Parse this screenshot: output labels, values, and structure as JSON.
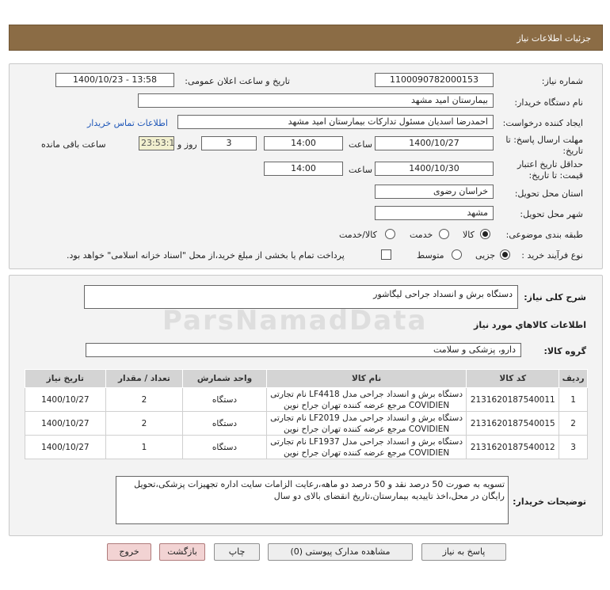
{
  "header": {
    "title": "جزئیات اطلاعات نیاز"
  },
  "form": {
    "need_number_label": "شماره نیاز:",
    "need_number": "1100090782000153",
    "announce_label": "تاریخ و ساعت اعلان عمومی:",
    "announce_value": "1400/10/23 - 13:58",
    "buyer_org_label": "نام دستگاه خریدار:",
    "buyer_org": "بیمارستان امید مشهد",
    "creator_label": "ایجاد کننده درخواست:",
    "creator": "احمدرضا اسدیان مسئول تدارکات بیمارستان امید مشهد",
    "contact_link": "اطلاعات تماس خریدار",
    "deadline_label_1": "مهلت ارسال پاسخ: تا",
    "deadline_label_2": "تاریخ:",
    "deadline_date": "1400/10/27",
    "time_label": "ساعت",
    "deadline_time": "14:00",
    "days_value": "3",
    "days_label": "روز و",
    "remaining_time": "23:53:19",
    "remaining_label": "ساعت باقی مانده",
    "validity_label_1": "حداقل تاریخ اعتبار",
    "validity_label_2": "قیمت: تا تاریخ:",
    "validity_date": "1400/10/30",
    "validity_time_label": "ساعت",
    "validity_time": "14:00",
    "province_label": "استان محل تحویل:",
    "province": "خراسان رضوی",
    "city_label": "شهر محل تحویل:",
    "city": "مشهد",
    "category_label": "طبقه بندی موضوعی:",
    "category_options": [
      "کالا",
      "خدمت",
      "کالا/خدمت"
    ],
    "process_label": "نوع فرآیند خرید :",
    "process_options": [
      "جزیی",
      "متوسط"
    ],
    "payment_note": "پرداخت تمام یا بخشی از مبلغ خرید،از محل \"اسناد خزانه اسلامی\" خواهد بود."
  },
  "details": {
    "summary_label": "شرح کلی نیاز:",
    "summary": "دستگاه برش و انسداد جراحی لیگاشور",
    "goods_info_title": "اطلاعات کالاهاي مورد نياز",
    "goods_group_label": "گروه کالا:",
    "goods_group": "دارو، پزشکی و سلامت",
    "table": {
      "headers": [
        "ردیف",
        "کد کالا",
        "نام کالا",
        "واحد شمارش",
        "تعداد / مقدار",
        "تاریخ نیاز"
      ],
      "rows": [
        {
          "row": "1",
          "code": "2131620187540011",
          "name_1": "دستگاه برش و انسداد جراحی مدل LF4418 نام تجارتی",
          "name_2": "COVIDIEN مرجع عرضه کننده تهران جراح نوین",
          "unit": "دستگاه",
          "qty": "2",
          "date": "1400/10/27"
        },
        {
          "row": "2",
          "code": "2131620187540015",
          "name_1": "دستگاه برش و انسداد جراحی مدل LF2019 نام تجارتی",
          "name_2": "COVIDIEN مرجع عرضه کننده تهران جراح نوین",
          "unit": "دستگاه",
          "qty": "2",
          "date": "1400/10/27"
        },
        {
          "row": "3",
          "code": "2131620187540012",
          "name_1": "دستگاه برش و انسداد جراحی مدل LF1937 نام تجارتی",
          "name_2": "COVIDIEN مرجع عرضه کننده تهران جراح نوین",
          "unit": "دستگاه",
          "qty": "1",
          "date": "1400/10/27"
        }
      ]
    },
    "buyer_notes_label": "توضیحات خریدار:",
    "buyer_notes": "تسویه به صورت 50 درصد نقد و 50 درصد دو ماهه،رعایت الزامات سایت اداره تجهیزات پزشکی،تحویل رایگان در محل،اخذ تاییدیه بیمارستان،تاریخ انقضای بالای دو سال"
  },
  "buttons": {
    "reply": "پاسخ به نیاز",
    "attachments": "مشاهده مدارک پیوستی (0)",
    "print": "چاپ",
    "back": "بازگشت",
    "exit": "خروج"
  },
  "watermark": "ParsNamadData",
  "colors": {
    "header_bg": "#8b6c45",
    "link": "#1f57b8",
    "table_header": "#d4d4d4",
    "red_button": "#f2d3d3"
  }
}
